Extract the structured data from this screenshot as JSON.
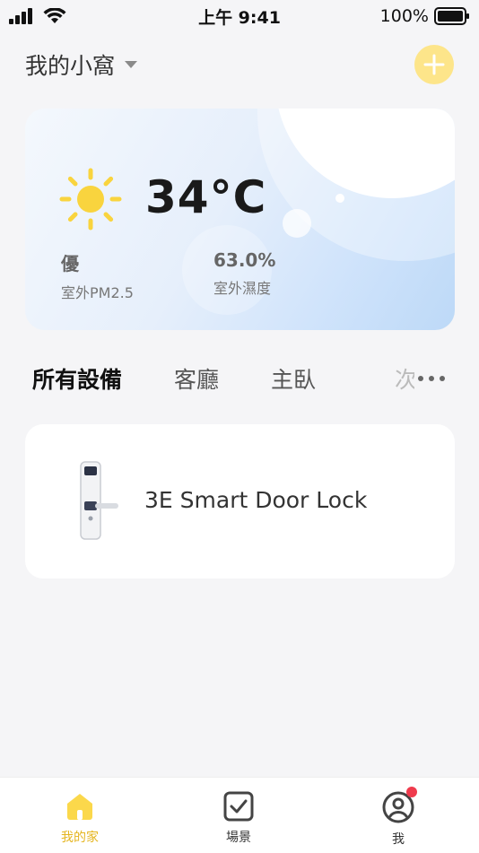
{
  "status_bar": {
    "time": "上午 9:41",
    "battery": "100%"
  },
  "header": {
    "home_name": "我的小窩",
    "icons": [
      "dropdown-arrow-icon",
      "plus-icon"
    ],
    "accent_color": "#fde58a"
  },
  "weather": {
    "temperature": "34°C",
    "air_quality": "優",
    "air_quality_label": "室外PM2.5",
    "humidity": "63.0%",
    "humidity_label": "室外濕度",
    "icon": "sun-icon",
    "sun_color": "#f9d43e"
  },
  "tabs": {
    "items": [
      "所有設備",
      "客廳",
      "主臥",
      "次"
    ]
  },
  "devices": [
    {
      "name": "3E Smart Door Lock",
      "icon": "door-lock-icon"
    }
  ],
  "bottom_nav": {
    "items": [
      {
        "label": "我的家",
        "icon": "home-icon",
        "active": true
      },
      {
        "label": "場景",
        "icon": "checkbox-icon",
        "active": false
      },
      {
        "label": "我",
        "icon": "user-icon",
        "active": false
      }
    ],
    "active_color": "#e5b520",
    "badge_color": "#ef3b4d"
  }
}
